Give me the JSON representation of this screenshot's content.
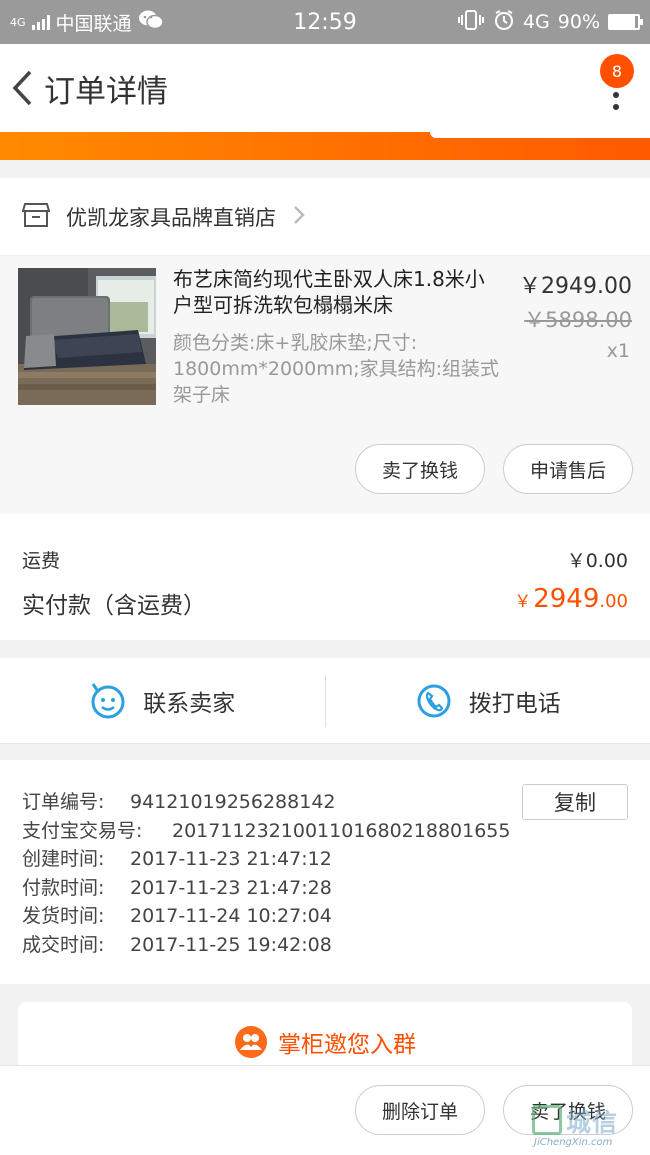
{
  "status_bar": {
    "network_small": "4G",
    "carrier": "中国联通",
    "time": "12:59",
    "network": "4G",
    "battery_text": "90%",
    "battery_level": 0.9
  },
  "header": {
    "title": "订单详情",
    "badge_count": "8"
  },
  "store": {
    "name": "优凯龙家具品牌直销店"
  },
  "product": {
    "title": "布艺床简约现代主卧双人床1.8米小户型可拆洗软包榻榻米床",
    "spec": "颜色分类:床+乳胶床垫;尺寸: 1800mm*2000mm;家具结构:组装式架子床",
    "price": "￥2949.00",
    "original_price": "￥5898.00",
    "quantity": "x1",
    "btn_sell": "卖了换钱",
    "btn_aftersale": "申请售后"
  },
  "cost": {
    "shipping_label": "运费",
    "shipping_value": "￥0.00",
    "paid_label": "实付款（含运费）",
    "paid_symbol": "￥",
    "paid_int": "2949",
    "paid_dec": ".00"
  },
  "contact": {
    "seller_label": "联系卖家",
    "phone_label": "拨打电话"
  },
  "order_info": {
    "copy_label": "复制",
    "rows": [
      {
        "label": "订单编号:",
        "value": "94121019256288142"
      },
      {
        "label": "支付宝交易号:",
        "value": "2017112321001101680218801655"
      },
      {
        "label": "创建时间:",
        "value": "2017-11-23 21:47:12"
      },
      {
        "label": "付款时间:",
        "value": "2017-11-23 21:47:28"
      },
      {
        "label": "发货时间:",
        "value": "2017-11-24 10:27:04"
      },
      {
        "label": "成交时间:",
        "value": "2017-11-25 19:42:08"
      }
    ]
  },
  "group": {
    "label": "掌柜邀您入群"
  },
  "bottom": {
    "delete_label": "删除订单",
    "sell_label": "卖了换钱"
  },
  "watermark": {
    "text": "城信",
    "sub": "JiChengXin.com"
  },
  "colors": {
    "accent": "#ff5000",
    "contact_blue": "#2aa0e0"
  }
}
